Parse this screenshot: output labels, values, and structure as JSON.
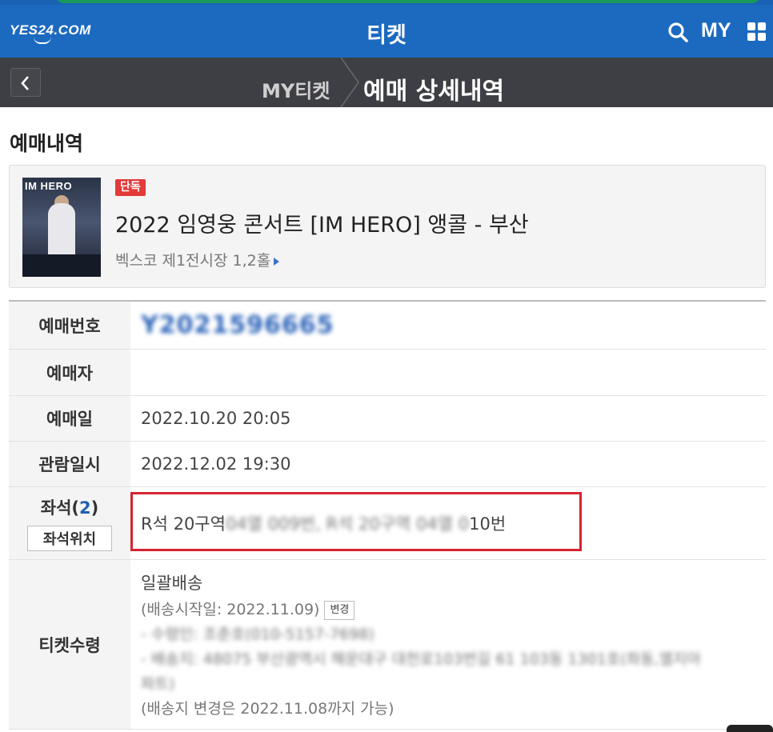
{
  "header": {
    "logo": "YES24.COM",
    "title": "티켓",
    "my_label": "MY"
  },
  "subnav": {
    "back_label": "<",
    "parent": "MY티켓",
    "current": "예매 상세내역"
  },
  "section_title": "예매내역",
  "event": {
    "poster_text": "IM HERO",
    "badge": "단독",
    "title": "2022 임영웅 콘서트 [IM HERO] 앵콜 - 부산",
    "venue": "벡스코 제1전시장 1,2홀"
  },
  "details": {
    "booking_no_label": "예매번호",
    "booking_no_value": "Y2021596665",
    "booker_label": "예매자",
    "booker_value": "",
    "booking_date_label": "예매일",
    "booking_date_value": "2022.10.20 20:05",
    "show_date_label": "관람일시",
    "show_date_value": "2022.12.02 19:30",
    "seat_label": "좌석(",
    "seat_count": "2",
    "seat_label_close": ")",
    "seat_location_button": "좌석위치",
    "seat_value_prefix": "R석 20구역",
    "seat_value_blur1": " 04열 009번, R석 20구역 04열 0",
    "seat_value_suffix": "10번",
    "ticket_label": "티켓수령",
    "ticket_method": "일괄배송",
    "ship_start": "(배송시작일: 2022.11.09)",
    "change_button": "변경",
    "receiver_blur": "- 수령인: 조춘호(010-5157-7698)",
    "address_blur": "- 배송지: 48075 부산광역시 해운대구 대천로103번길 61 103동 1301호(좌동,엘지아",
    "address_blur2": "파트)",
    "ship_change_note": "(배송지 변경은 2022.11.08까지 가능)"
  }
}
